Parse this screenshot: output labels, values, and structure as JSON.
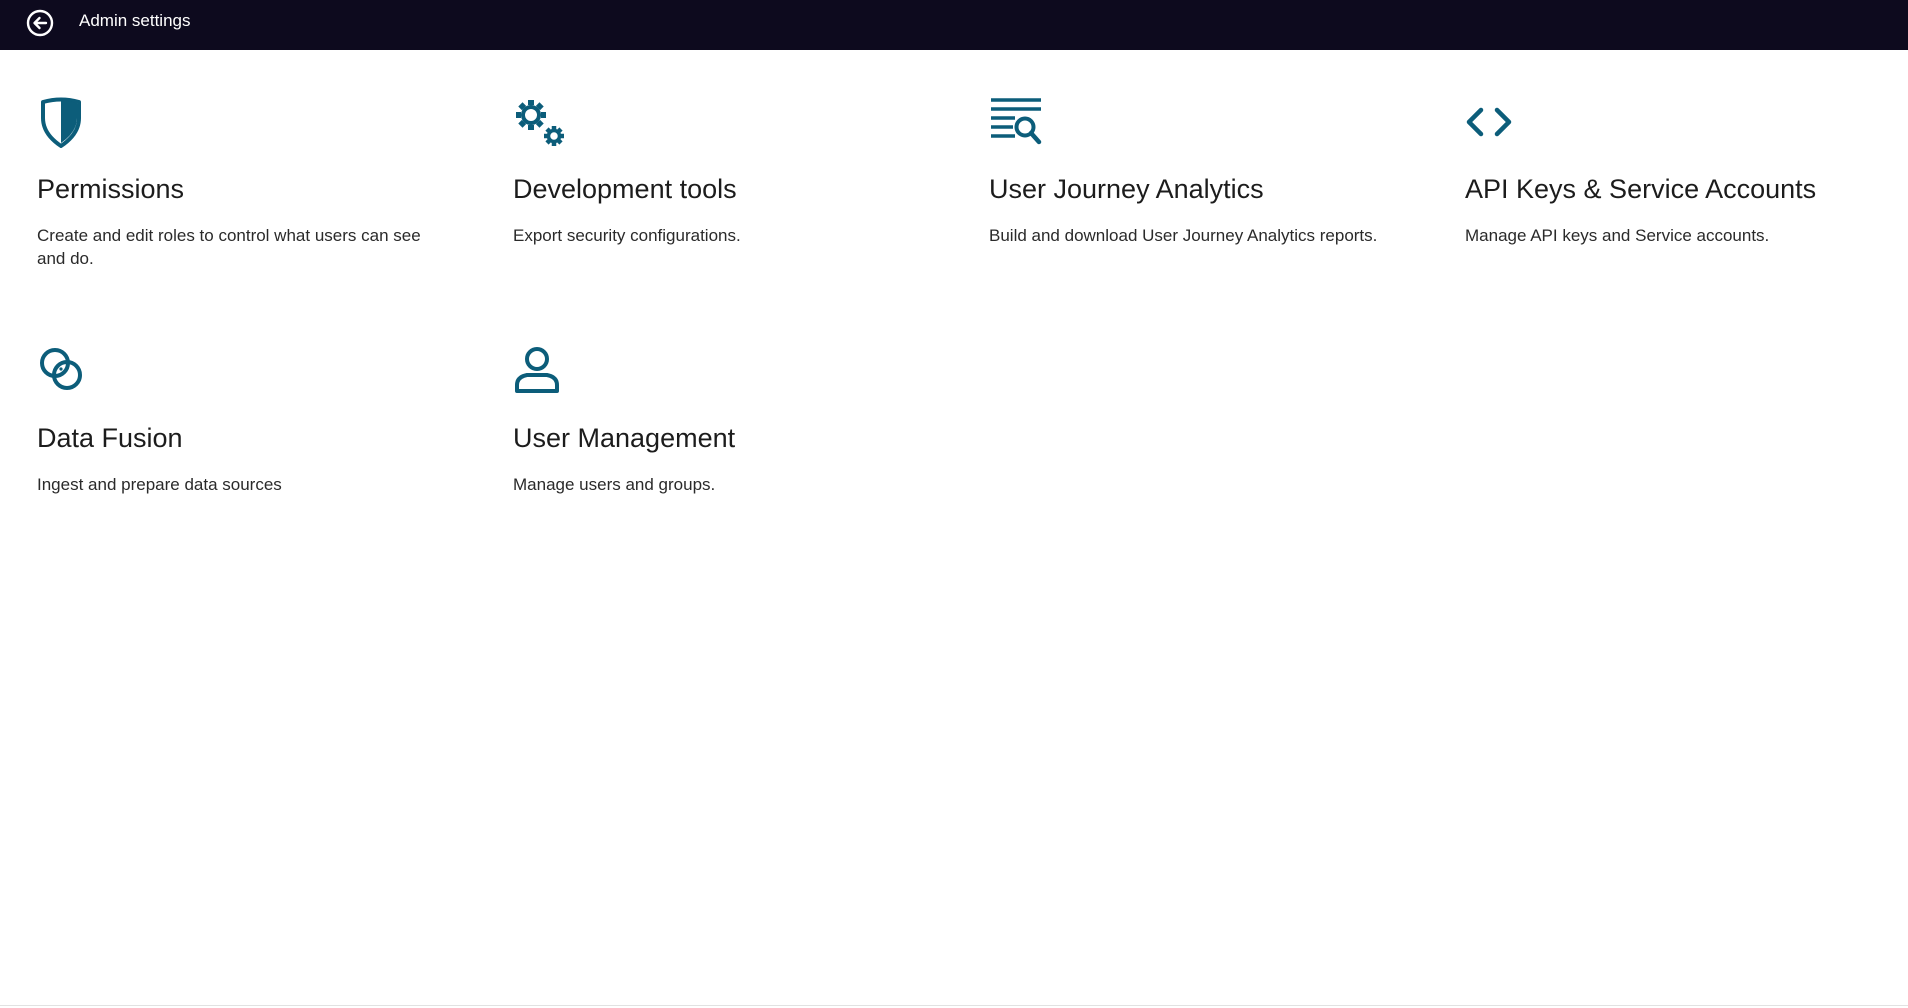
{
  "header": {
    "title": "Admin settings",
    "back_icon": "back-arrow-circle-icon",
    "background_color": "#0d0a1e"
  },
  "accent_color": "#0c5d7a",
  "cards": [
    {
      "icon": "shield-icon",
      "title": "Permissions",
      "description": "Create and edit roles to control what users can see and do."
    },
    {
      "icon": "gears-icon",
      "title": "Development tools",
      "description": "Export security configurations."
    },
    {
      "icon": "list-search-icon",
      "title": "User Journey Analytics",
      "description": "Build and download User Journey Analytics reports."
    },
    {
      "icon": "code-brackets-icon",
      "title": "API Keys & Service Accounts",
      "description": "Manage API keys and Service accounts."
    },
    {
      "icon": "data-fusion-icon",
      "title": "Data Fusion",
      "description": "Ingest and prepare data sources"
    },
    {
      "icon": "user-icon",
      "title": "User Management",
      "description": "Manage users and groups."
    }
  ]
}
